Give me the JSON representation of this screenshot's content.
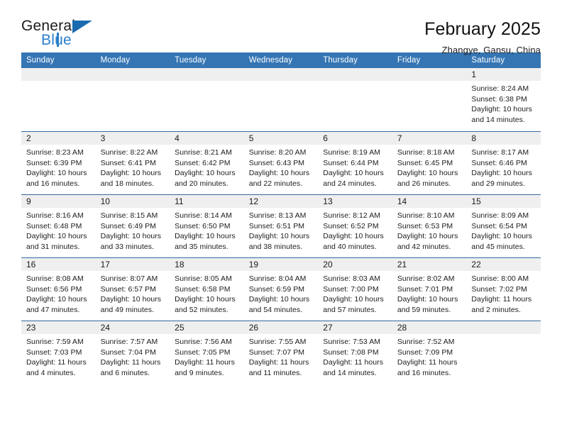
{
  "logo": {
    "word_top": "General",
    "word_bottom": "Blue",
    "triangle_color": "#1a6bb0",
    "blue_color": "#2a7fc9"
  },
  "header": {
    "title": "February 2025",
    "subtitle": "Zhangye, Gansu, China"
  },
  "theme": {
    "header_blue": "#3575b4",
    "daynum_band": "#efefef",
    "row_separator": "#35699f"
  },
  "weekdays": [
    "Sunday",
    "Monday",
    "Tuesday",
    "Wednesday",
    "Thursday",
    "Friday",
    "Saturday"
  ],
  "weeks": [
    [
      {
        "day": "",
        "lines": []
      },
      {
        "day": "",
        "lines": []
      },
      {
        "day": "",
        "lines": []
      },
      {
        "day": "",
        "lines": []
      },
      {
        "day": "",
        "lines": []
      },
      {
        "day": "",
        "lines": []
      },
      {
        "day": "1",
        "lines": [
          "Sunrise: 8:24 AM",
          "Sunset: 6:38 PM",
          "Daylight: 10 hours",
          "and 14 minutes."
        ]
      }
    ],
    [
      {
        "day": "2",
        "lines": [
          "Sunrise: 8:23 AM",
          "Sunset: 6:39 PM",
          "Daylight: 10 hours",
          "and 16 minutes."
        ]
      },
      {
        "day": "3",
        "lines": [
          "Sunrise: 8:22 AM",
          "Sunset: 6:41 PM",
          "Daylight: 10 hours",
          "and 18 minutes."
        ]
      },
      {
        "day": "4",
        "lines": [
          "Sunrise: 8:21 AM",
          "Sunset: 6:42 PM",
          "Daylight: 10 hours",
          "and 20 minutes."
        ]
      },
      {
        "day": "5",
        "lines": [
          "Sunrise: 8:20 AM",
          "Sunset: 6:43 PM",
          "Daylight: 10 hours",
          "and 22 minutes."
        ]
      },
      {
        "day": "6",
        "lines": [
          "Sunrise: 8:19 AM",
          "Sunset: 6:44 PM",
          "Daylight: 10 hours",
          "and 24 minutes."
        ]
      },
      {
        "day": "7",
        "lines": [
          "Sunrise: 8:18 AM",
          "Sunset: 6:45 PM",
          "Daylight: 10 hours",
          "and 26 minutes."
        ]
      },
      {
        "day": "8",
        "lines": [
          "Sunrise: 8:17 AM",
          "Sunset: 6:46 PM",
          "Daylight: 10 hours",
          "and 29 minutes."
        ]
      }
    ],
    [
      {
        "day": "9",
        "lines": [
          "Sunrise: 8:16 AM",
          "Sunset: 6:48 PM",
          "Daylight: 10 hours",
          "and 31 minutes."
        ]
      },
      {
        "day": "10",
        "lines": [
          "Sunrise: 8:15 AM",
          "Sunset: 6:49 PM",
          "Daylight: 10 hours",
          "and 33 minutes."
        ]
      },
      {
        "day": "11",
        "lines": [
          "Sunrise: 8:14 AM",
          "Sunset: 6:50 PM",
          "Daylight: 10 hours",
          "and 35 minutes."
        ]
      },
      {
        "day": "12",
        "lines": [
          "Sunrise: 8:13 AM",
          "Sunset: 6:51 PM",
          "Daylight: 10 hours",
          "and 38 minutes."
        ]
      },
      {
        "day": "13",
        "lines": [
          "Sunrise: 8:12 AM",
          "Sunset: 6:52 PM",
          "Daylight: 10 hours",
          "and 40 minutes."
        ]
      },
      {
        "day": "14",
        "lines": [
          "Sunrise: 8:10 AM",
          "Sunset: 6:53 PM",
          "Daylight: 10 hours",
          "and 42 minutes."
        ]
      },
      {
        "day": "15",
        "lines": [
          "Sunrise: 8:09 AM",
          "Sunset: 6:54 PM",
          "Daylight: 10 hours",
          "and 45 minutes."
        ]
      }
    ],
    [
      {
        "day": "16",
        "lines": [
          "Sunrise: 8:08 AM",
          "Sunset: 6:56 PM",
          "Daylight: 10 hours",
          "and 47 minutes."
        ]
      },
      {
        "day": "17",
        "lines": [
          "Sunrise: 8:07 AM",
          "Sunset: 6:57 PM",
          "Daylight: 10 hours",
          "and 49 minutes."
        ]
      },
      {
        "day": "18",
        "lines": [
          "Sunrise: 8:05 AM",
          "Sunset: 6:58 PM",
          "Daylight: 10 hours",
          "and 52 minutes."
        ]
      },
      {
        "day": "19",
        "lines": [
          "Sunrise: 8:04 AM",
          "Sunset: 6:59 PM",
          "Daylight: 10 hours",
          "and 54 minutes."
        ]
      },
      {
        "day": "20",
        "lines": [
          "Sunrise: 8:03 AM",
          "Sunset: 7:00 PM",
          "Daylight: 10 hours",
          "and 57 minutes."
        ]
      },
      {
        "day": "21",
        "lines": [
          "Sunrise: 8:02 AM",
          "Sunset: 7:01 PM",
          "Daylight: 10 hours",
          "and 59 minutes."
        ]
      },
      {
        "day": "22",
        "lines": [
          "Sunrise: 8:00 AM",
          "Sunset: 7:02 PM",
          "Daylight: 11 hours",
          "and 2 minutes."
        ]
      }
    ],
    [
      {
        "day": "23",
        "lines": [
          "Sunrise: 7:59 AM",
          "Sunset: 7:03 PM",
          "Daylight: 11 hours",
          "and 4 minutes."
        ]
      },
      {
        "day": "24",
        "lines": [
          "Sunrise: 7:57 AM",
          "Sunset: 7:04 PM",
          "Daylight: 11 hours",
          "and 6 minutes."
        ]
      },
      {
        "day": "25",
        "lines": [
          "Sunrise: 7:56 AM",
          "Sunset: 7:05 PM",
          "Daylight: 11 hours",
          "and 9 minutes."
        ]
      },
      {
        "day": "26",
        "lines": [
          "Sunrise: 7:55 AM",
          "Sunset: 7:07 PM",
          "Daylight: 11 hours",
          "and 11 minutes."
        ]
      },
      {
        "day": "27",
        "lines": [
          "Sunrise: 7:53 AM",
          "Sunset: 7:08 PM",
          "Daylight: 11 hours",
          "and 14 minutes."
        ]
      },
      {
        "day": "28",
        "lines": [
          "Sunrise: 7:52 AM",
          "Sunset: 7:09 PM",
          "Daylight: 11 hours",
          "and 16 minutes."
        ]
      },
      {
        "day": "",
        "lines": []
      }
    ]
  ]
}
